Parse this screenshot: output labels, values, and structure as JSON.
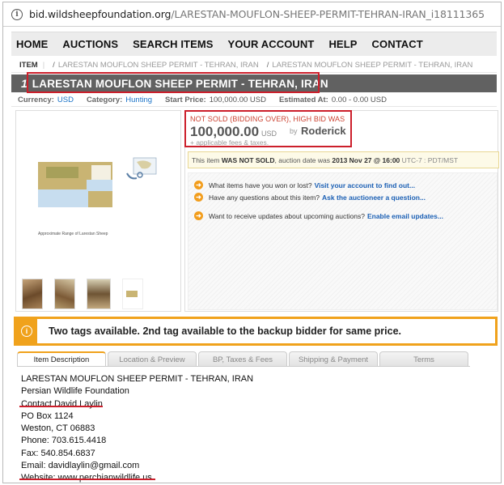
{
  "browser": {
    "url_domain": "bid.wildsheepfoundation.org",
    "url_path": "/LARESTAN-MOUFLON-SHEEP-PERMIT-TEHRAN-IRAN_i18111365"
  },
  "nav": {
    "items": [
      "HOME",
      "AUCTIONS",
      "SEARCH ITEMS",
      "YOUR ACCOUNT",
      "HELP",
      "CONTACT"
    ]
  },
  "breadcrumb": {
    "item_label": "ITEM",
    "separator": "/",
    "crumbs": [
      "LARESTAN MOUFLON SHEEP PERMIT - TEHRAN, IRAN",
      "LARESTAN MOUFLON SHEEP PERMIT - TEHRAN, IRAN"
    ]
  },
  "title": {
    "lot_number": "1",
    "text": "LARESTAN MOUFLON SHEEP PERMIT - TEHRAN, IRAN"
  },
  "meta": {
    "currency_label": "Currency:",
    "currency_value": "USD",
    "category_label": "Category:",
    "category_value": "Hunting",
    "start_price_label": "Start Price:",
    "start_price_value": "100,000.00 USD",
    "estimated_label": "Estimated At:",
    "estimated_value": "0.00 - 0.00 USD"
  },
  "bid": {
    "status": "NOT SOLD (BIDDING OVER), HIGH BID WAS",
    "amount": "100,000.00",
    "currency": "USD",
    "by": "by",
    "bidder": "Roderick",
    "fees": "+ applicable fees & taxes.",
    "notice_prefix": "This item",
    "notice_bold1": "WAS NOT SOLD",
    "notice_mid": ", auction date was",
    "notice_bold2": "2013 Nov 27 @ 16:00",
    "notice_tz": "UTC-7 : PDT/MST"
  },
  "actions": [
    {
      "text": "What items have you won or lost?",
      "link": "Visit your account to find out..."
    },
    {
      "text": "Have any questions about this item?",
      "link": "Ask the auctioneer a question..."
    },
    {
      "text": "Want to receive updates about upcoming auctions?",
      "link": "Enable email updates..."
    }
  ],
  "gallery": {
    "map_caption": "Approximate Range of Larestan Sheep"
  },
  "tags_notice": "Two tags available. 2nd tag available to the backup bidder for same price.",
  "tabs": [
    "Item Description",
    "Location & Preview",
    "BP, Taxes & Fees",
    "Shipping & Payment",
    "Terms"
  ],
  "description": [
    "LARESTAN MOUFLON SHEEP PERMIT - TEHRAN, IRAN",
    "Persian Wildlife Foundation",
    "Contact David Laylin",
    "PO Box 1124",
    "Weston, CT 06883",
    "Phone: 703.615.4418",
    "Fax: 540.854.6837",
    "Email: davidlaylin@gmail.com",
    "Website: www.perchianwildlife.us"
  ],
  "colors": {
    "annotation_red": "#cc1f2b",
    "accent_orange": "#f0a21c",
    "title_bar": "#616161",
    "link_blue": "#1a5fb4"
  }
}
